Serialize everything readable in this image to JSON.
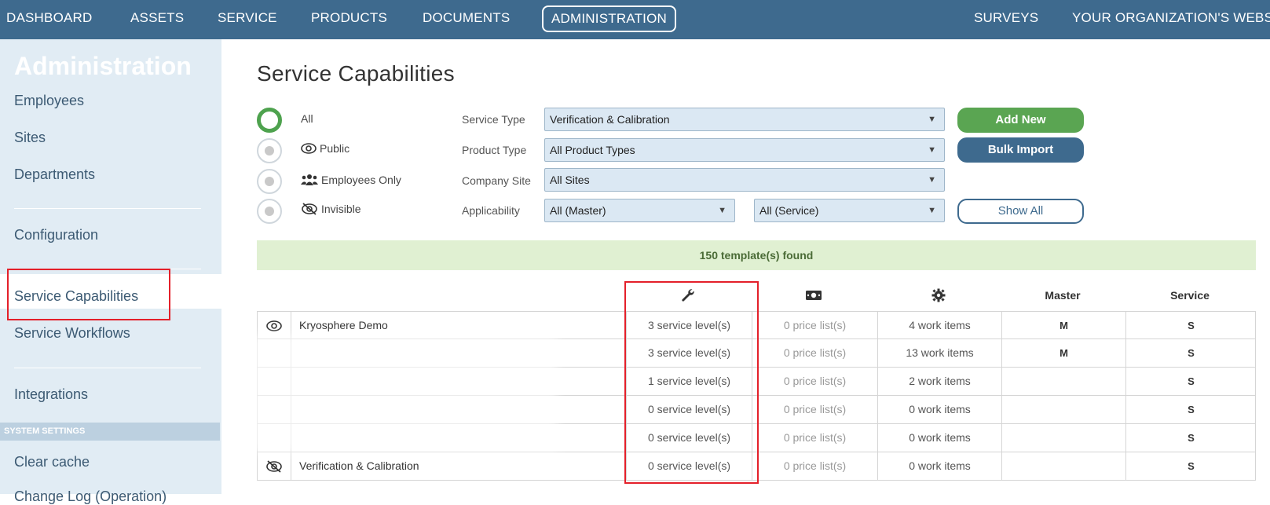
{
  "nav": {
    "items": [
      "DASHBOARD",
      "ASSETS",
      "SERVICE",
      "PRODUCTS",
      "DOCUMENTS",
      "ADMINISTRATION"
    ],
    "right_items": [
      "SURVEYS",
      "YOUR ORGANIZATION'S WEBS"
    ]
  },
  "sidebar": {
    "title": "Administration",
    "items": [
      "Employees",
      "Sites",
      "Departments",
      "Configuration",
      "Service Capabilities",
      "Service Workflows",
      "Integrations",
      "Clear cache",
      "Change Log (Operation)"
    ],
    "section_header": "SYSTEM SETTINGS"
  },
  "page": {
    "title": "Service Capabilities"
  },
  "visibility_filter": {
    "options": [
      "All",
      "Public",
      "Employees Only",
      "Invisible"
    ],
    "selected": "All"
  },
  "filters": {
    "service_type": {
      "label": "Service Type",
      "value": "Verification & Calibration"
    },
    "product_type": {
      "label": "Product Type",
      "value": "All Product Types"
    },
    "company_site": {
      "label": "Company Site",
      "value": "All Sites"
    },
    "applicability": {
      "label": "Applicability",
      "master_value": "All (Master)",
      "service_value": "All (Service)"
    }
  },
  "buttons": {
    "add_new": "Add New",
    "bulk_import": "Bulk Import",
    "show_all": "Show All"
  },
  "results": {
    "found_text": "150 template(s) found"
  },
  "table": {
    "headers": {
      "service_levels_icon": "wrench-icon",
      "price_lists_icon": "money-icon",
      "work_items_icon": "gear-icon",
      "master": "Master",
      "service": "Service"
    },
    "rows": [
      {
        "visibility_icon": "eye-icon",
        "name": "Kryosphere Demo",
        "service_levels": "3 service level(s)",
        "price_lists": "0 price list(s)",
        "work_items": "4 work items",
        "master": "M",
        "service": "S"
      },
      {
        "visibility_icon": "",
        "name": "",
        "service_levels": "3 service level(s)",
        "price_lists": "0 price list(s)",
        "work_items": "13 work items",
        "master": "M",
        "service": "S"
      },
      {
        "visibility_icon": "",
        "name": "",
        "service_levels": "1 service level(s)",
        "price_lists": "0 price list(s)",
        "work_items": "2 work items",
        "master": "",
        "service": "S"
      },
      {
        "visibility_icon": "",
        "name": "",
        "service_levels": "0 service level(s)",
        "price_lists": "0 price list(s)",
        "work_items": "0 work items",
        "master": "",
        "service": "S"
      },
      {
        "visibility_icon": "",
        "name": "",
        "service_levels": "0 service level(s)",
        "price_lists": "0 price list(s)",
        "work_items": "0 work items",
        "master": "",
        "service": "S"
      },
      {
        "visibility_icon": "eye-slash-icon",
        "name": "Verification & Calibration",
        "service_levels": "0 service level(s)",
        "price_lists": "0 price list(s)",
        "work_items": "0 work items",
        "master": "",
        "service": "S"
      }
    ]
  },
  "colors": {
    "nav_bg": "#3e6a8e",
    "sidebar_bg": "#e1ecf4",
    "accent_green": "#5aa552",
    "found_bg": "#e0f0d2",
    "highlight_red": "#e4202a"
  }
}
